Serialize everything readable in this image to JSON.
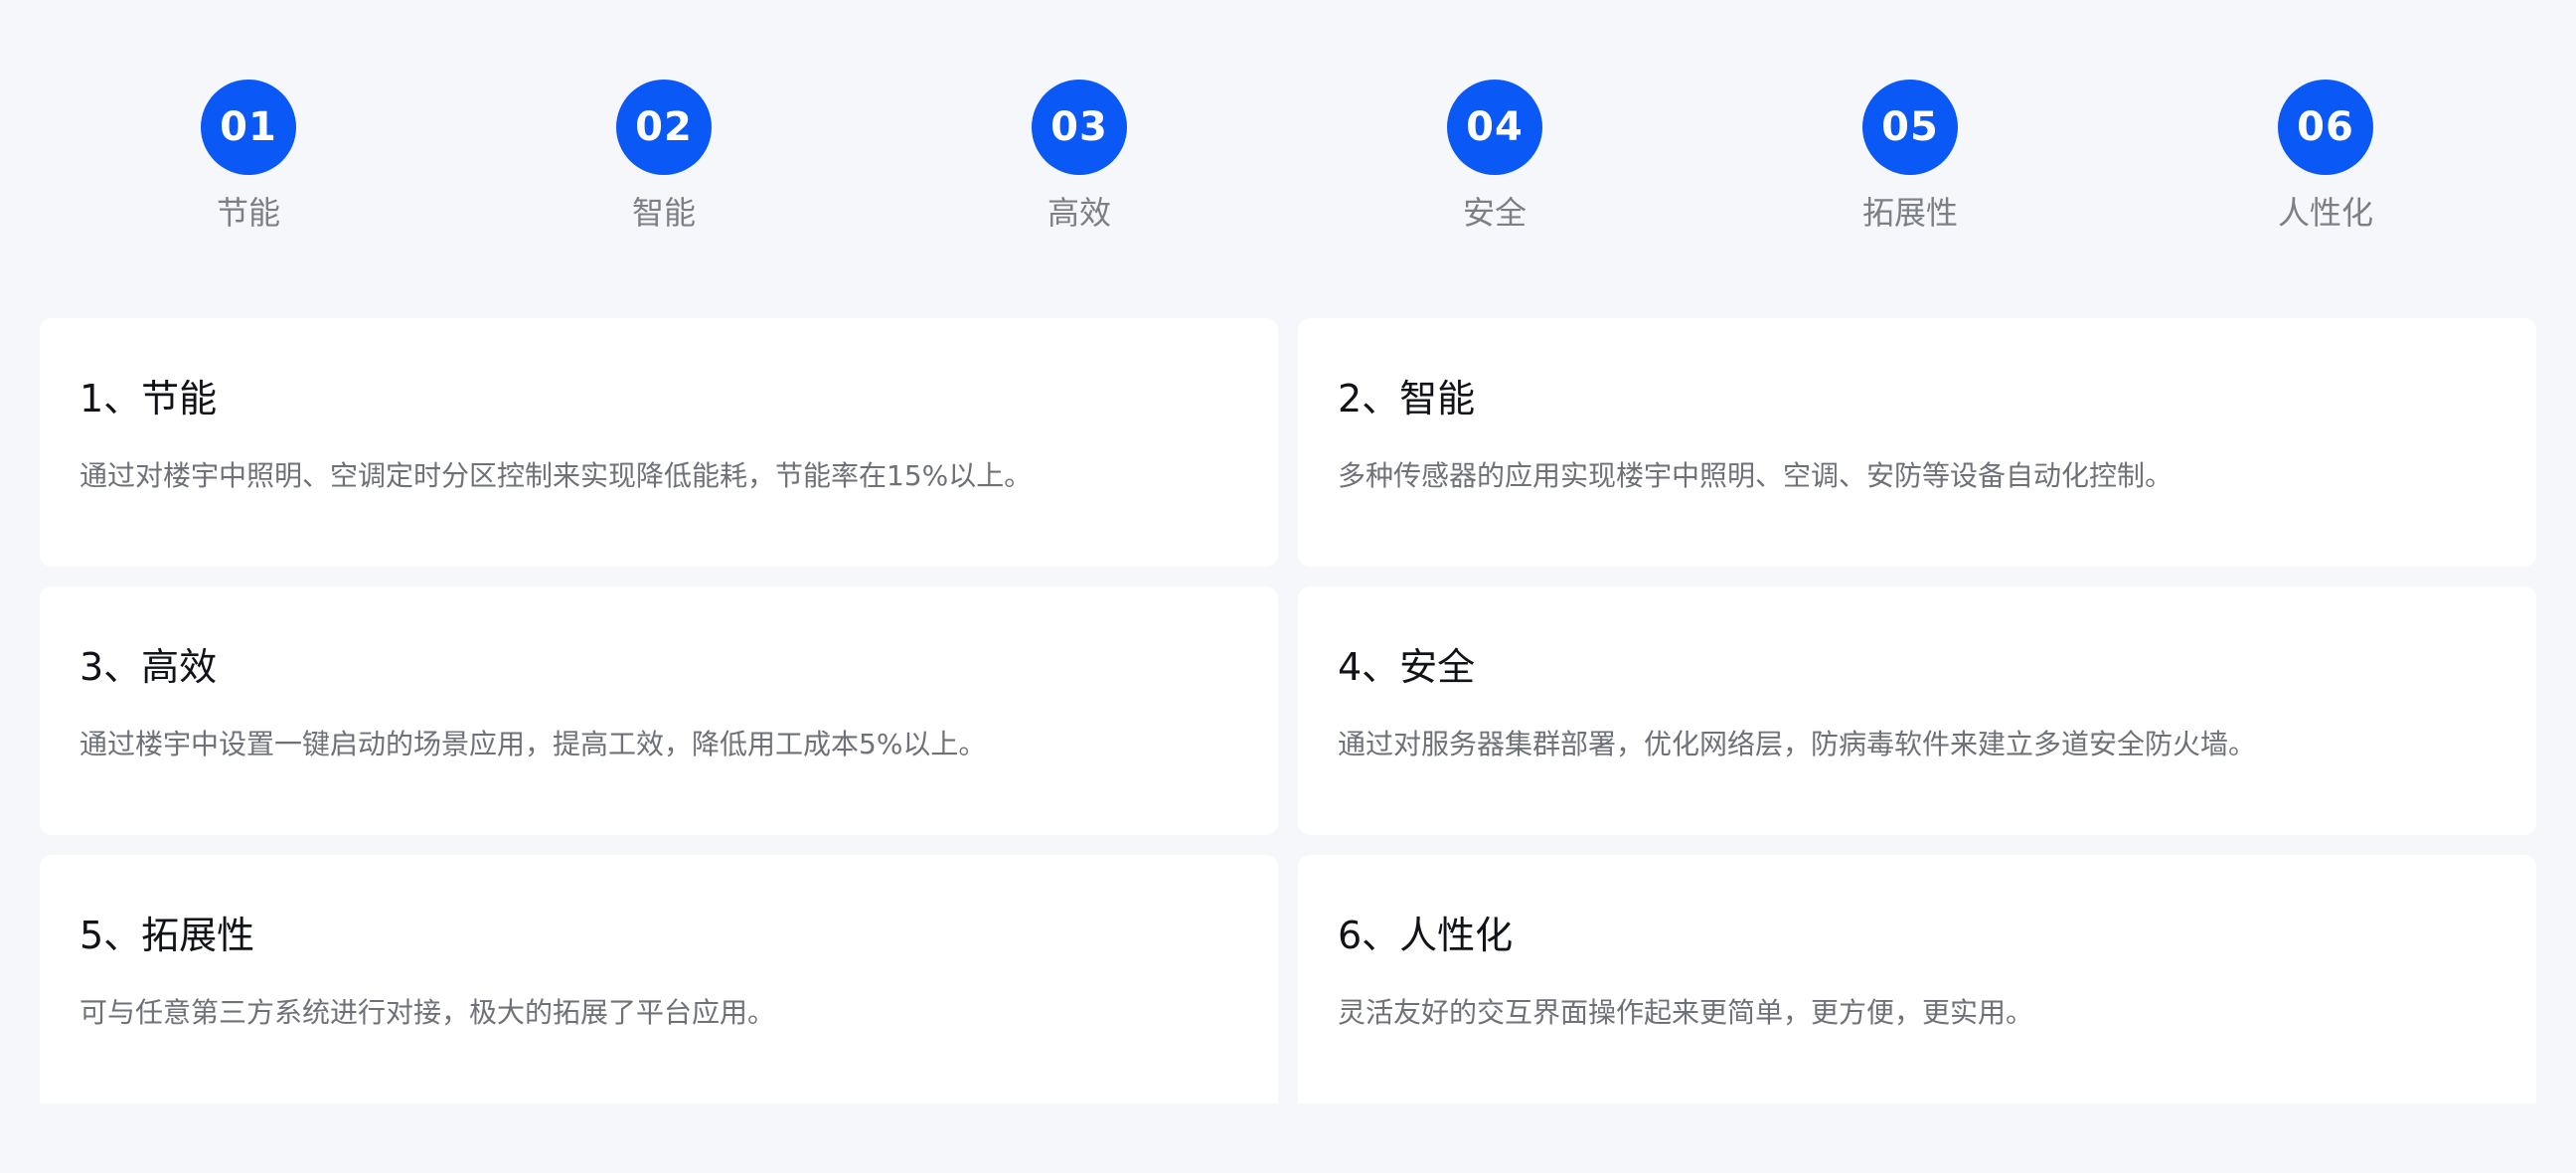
{
  "steps": [
    {
      "number": "01",
      "label": "节能"
    },
    {
      "number": "02",
      "label": "智能"
    },
    {
      "number": "03",
      "label": "高效"
    },
    {
      "number": "04",
      "label": "安全"
    },
    {
      "number": "05",
      "label": "拓展性"
    },
    {
      "number": "06",
      "label": "人性化"
    }
  ],
  "cards": [
    {
      "title": "1、节能",
      "description": "通过对楼宇中照明、空调定时分区控制来实现降低能耗，节能率在15%以上。"
    },
    {
      "title": "2、智能",
      "description": "多种传感器的应用实现楼宇中照明、空调、安防等设备自动化控制。"
    },
    {
      "title": "3、高效",
      "description": "通过楼宇中设置一键启动的场景应用，提高工效，降低用工成本5%以上。"
    },
    {
      "title": "4、安全",
      "description": "通过对服务器集群部署，优化网络层，防病毒软件来建立多道安全防火墙。"
    },
    {
      "title": "5、拓展性",
      "description": "可与任意第三方系统进行对接，极大的拓展了平台应用。"
    },
    {
      "title": "6、人性化",
      "description": "灵活友好的交互界面操作起来更简单，更方便，更实用。"
    }
  ],
  "colors": {
    "accent": "#0a58f5",
    "background": "#f6f7fb",
    "card": "#ffffff",
    "title": "#111318",
    "text": "#6f7178"
  }
}
